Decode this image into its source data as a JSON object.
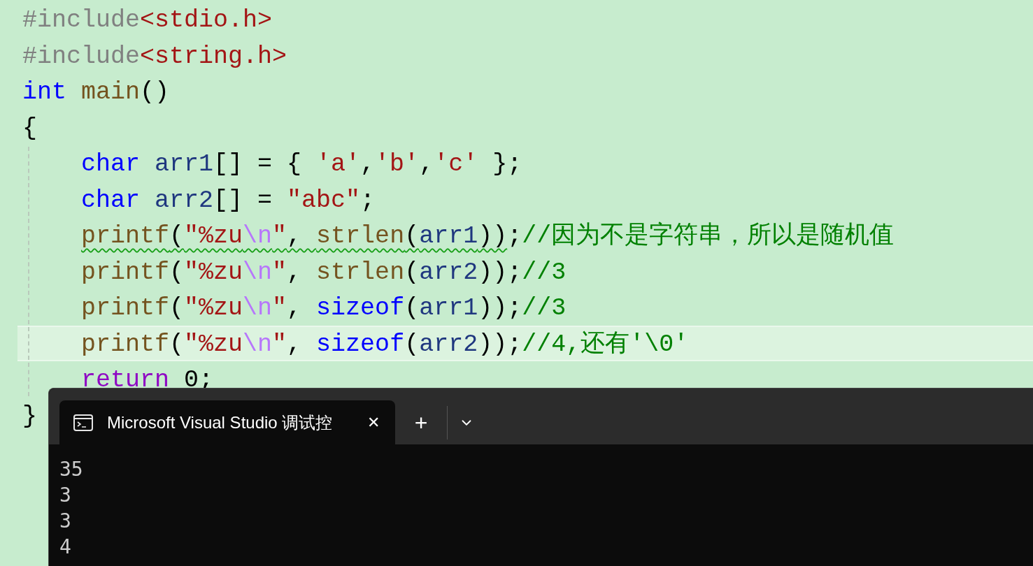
{
  "editor": {
    "lines": [
      {
        "current": false,
        "indented": false,
        "tokens": [
          {
            "kind": "preprocessor",
            "text": "#include"
          },
          {
            "kind": "header",
            "text": "<stdio.h>"
          }
        ]
      },
      {
        "current": false,
        "indented": false,
        "tokens": [
          {
            "kind": "preprocessor",
            "text": "#include"
          },
          {
            "kind": "header",
            "text": "<string.h>"
          }
        ]
      },
      {
        "current": false,
        "indented": false,
        "tokens": [
          {
            "kind": "keyword",
            "text": "int"
          },
          {
            "kind": "function",
            "text": " main"
          },
          {
            "kind": "plain",
            "text": "()"
          }
        ]
      },
      {
        "current": false,
        "indented": false,
        "tokens": [
          {
            "kind": "plain",
            "text": "{"
          }
        ]
      },
      {
        "current": false,
        "indented": true,
        "tokens": [
          {
            "kind": "keyword",
            "text": "char"
          },
          {
            "kind": "variable",
            "text": " arr1"
          },
          {
            "kind": "plain",
            "text": "[] = { "
          },
          {
            "kind": "string",
            "text": "'a'"
          },
          {
            "kind": "plain",
            "text": ","
          },
          {
            "kind": "string",
            "text": "'b'"
          },
          {
            "kind": "plain",
            "text": ","
          },
          {
            "kind": "string",
            "text": "'c'"
          },
          {
            "kind": "plain",
            "text": " };"
          }
        ]
      },
      {
        "current": false,
        "indented": true,
        "tokens": [
          {
            "kind": "keyword",
            "text": "char"
          },
          {
            "kind": "variable",
            "text": " arr2"
          },
          {
            "kind": "plain",
            "text": "[] = "
          },
          {
            "kind": "string",
            "text": "\"abc\""
          },
          {
            "kind": "plain",
            "text": ";"
          }
        ]
      },
      {
        "current": false,
        "indented": true,
        "warning_tokens": [
          {
            "kind": "function",
            "text": "printf"
          },
          {
            "kind": "plain",
            "text": "("
          },
          {
            "kind": "string",
            "text": "\"%zu"
          },
          {
            "kind": "escape",
            "text": "\\n"
          },
          {
            "kind": "string",
            "text": "\""
          },
          {
            "kind": "plain",
            "text": ", "
          },
          {
            "kind": "function",
            "text": "strlen"
          },
          {
            "kind": "plain",
            "text": "("
          },
          {
            "kind": "variable",
            "text": "arr1"
          },
          {
            "kind": "plain",
            "text": "))"
          }
        ],
        "tokens": [
          {
            "kind": "plain",
            "text": ";"
          },
          {
            "kind": "comment",
            "text": "//因为不是字符串，所以是随机值"
          }
        ]
      },
      {
        "current": false,
        "indented": true,
        "tokens": [
          {
            "kind": "function",
            "text": "printf"
          },
          {
            "kind": "plain",
            "text": "("
          },
          {
            "kind": "string",
            "text": "\"%zu"
          },
          {
            "kind": "escape",
            "text": "\\n"
          },
          {
            "kind": "string",
            "text": "\""
          },
          {
            "kind": "plain",
            "text": ", "
          },
          {
            "kind": "function",
            "text": "strlen"
          },
          {
            "kind": "plain",
            "text": "("
          },
          {
            "kind": "variable",
            "text": "arr2"
          },
          {
            "kind": "plain",
            "text": "));"
          },
          {
            "kind": "comment",
            "text": "//3"
          }
        ]
      },
      {
        "current": false,
        "indented": true,
        "tokens": [
          {
            "kind": "function",
            "text": "printf"
          },
          {
            "kind": "plain",
            "text": "("
          },
          {
            "kind": "string",
            "text": "\"%zu"
          },
          {
            "kind": "escape",
            "text": "\\n"
          },
          {
            "kind": "string",
            "text": "\""
          },
          {
            "kind": "plain",
            "text": ", "
          },
          {
            "kind": "keyword",
            "text": "sizeof"
          },
          {
            "kind": "plain",
            "text": "("
          },
          {
            "kind": "variable",
            "text": "arr1"
          },
          {
            "kind": "plain",
            "text": "));"
          },
          {
            "kind": "comment",
            "text": "//3"
          }
        ]
      },
      {
        "current": true,
        "indented": true,
        "tokens": [
          {
            "kind": "function",
            "text": "printf"
          },
          {
            "kind": "plain",
            "text": "("
          },
          {
            "kind": "string",
            "text": "\"%zu"
          },
          {
            "kind": "escape",
            "text": "\\n"
          },
          {
            "kind": "string",
            "text": "\""
          },
          {
            "kind": "plain",
            "text": ", "
          },
          {
            "kind": "keyword",
            "text": "sizeof"
          },
          {
            "kind": "plain",
            "text": "("
          },
          {
            "kind": "variable",
            "text": "arr2"
          },
          {
            "kind": "plain",
            "text": "));"
          },
          {
            "kind": "comment",
            "text": "//4,还有'\\0'"
          }
        ]
      },
      {
        "current": false,
        "indented": true,
        "tokens": [
          {
            "kind": "control",
            "text": "return"
          },
          {
            "kind": "plain",
            "text": " 0;"
          }
        ]
      },
      {
        "current": false,
        "indented": false,
        "tokens": [
          {
            "kind": "plain",
            "text": "}"
          }
        ]
      }
    ]
  },
  "terminal": {
    "tab": {
      "title": "Microsoft Visual Studio 调试控",
      "close": "✕"
    },
    "new_tab": "+",
    "output": [
      "35",
      "3",
      "3",
      "4"
    ]
  }
}
